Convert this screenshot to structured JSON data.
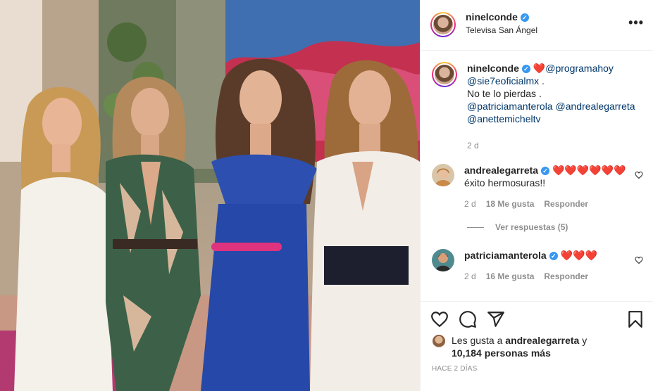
{
  "post": {
    "username": "ninelconde",
    "location": "Televisa San Ángel",
    "more_icon": "more-options-icon"
  },
  "caption": {
    "username": "ninelconde",
    "heart": "❤️",
    "line1_mention": "@programahoy",
    "line2_mention": "@sie7eoficialmx",
    "line2_suffix": " .",
    "line3": "No te lo pierdas .",
    "mention_a": "@patriciamanterola",
    "mention_b": "@andrealegarreta",
    "mention_c": "@anettemicheltv",
    "age": "2 d"
  },
  "comments": [
    {
      "username": "andrealegarreta",
      "hearts": "❤️❤️❤️❤️❤️❤️",
      "text": "éxito hermosuras!!",
      "age": "2 d",
      "likes": "18 Me gusta",
      "reply_label": "Responder"
    },
    {
      "username": "patriciamanterola",
      "hearts": "❤️❤️❤️",
      "text": "",
      "age": "2 d",
      "likes": "16 Me gusta",
      "reply_label": "Responder"
    }
  ],
  "replies_toggle": "Ver respuestas (5)",
  "likes": {
    "prefix": "Les gusta a ",
    "user": "andrealegarreta",
    "connector": " y",
    "count": "10,184 personas más"
  },
  "time_ago": "HACE 2 DÍAS",
  "colors": {
    "verified": "#3897f0",
    "mention": "#00376b",
    "heart": "#ed4956",
    "muted": "#8e8e8e",
    "text": "#262626",
    "divider": "#efefef"
  }
}
